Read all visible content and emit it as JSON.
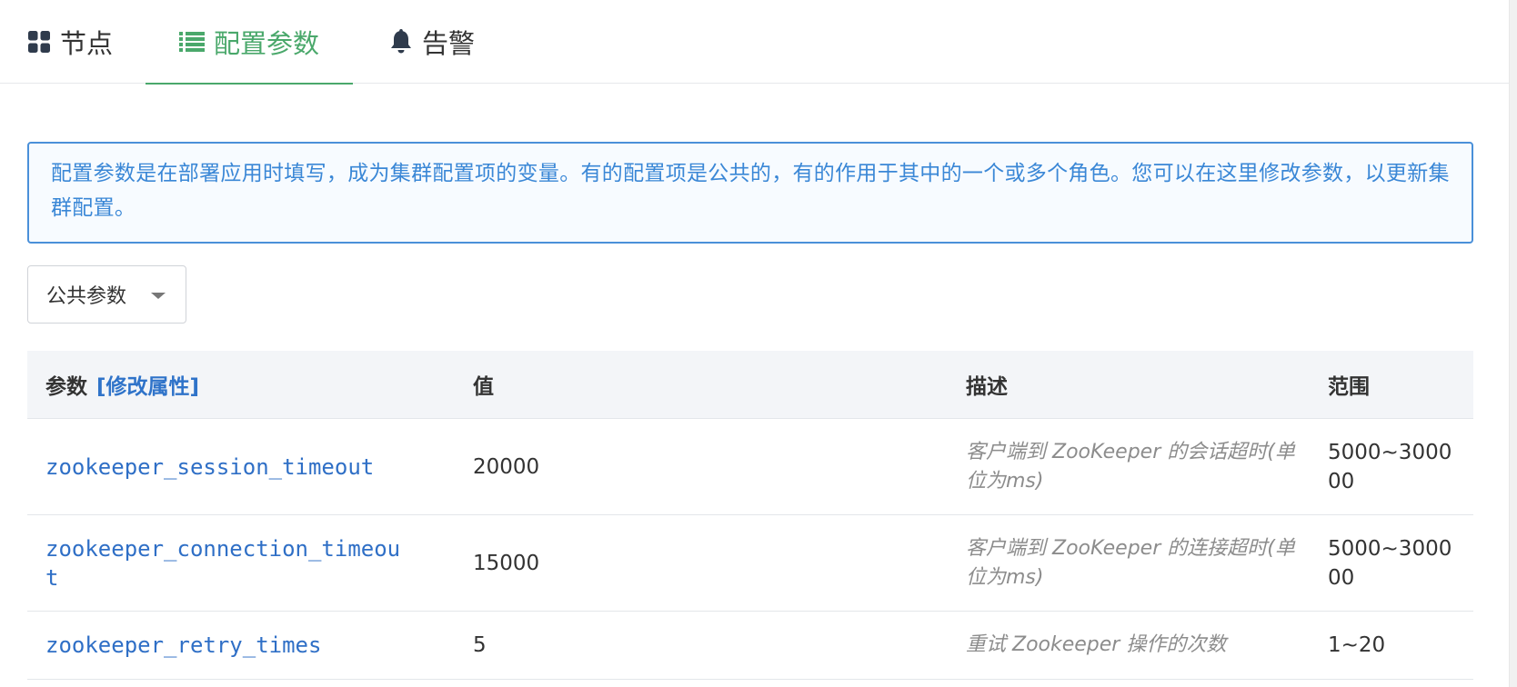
{
  "tabs": [
    {
      "label": "节点",
      "icon": "grid-icon",
      "active": false
    },
    {
      "label": "配置参数",
      "icon": "list-icon",
      "active": true
    },
    {
      "label": "告警",
      "icon": "bell-icon",
      "active": false
    }
  ],
  "alert": {
    "text": "配置参数是在部署应用时填写，成为集群配置项的变量。有的配置项是公共的，有的作用于其中的一个或多个角色。您可以在这里修改参数，以更新集群配置。"
  },
  "scope_select": {
    "value": "公共参数"
  },
  "table": {
    "headers": {
      "param": "参数",
      "edit_link": "[修改属性]",
      "value": "值",
      "description": "描述",
      "range": "范围"
    },
    "rows": [
      {
        "param": "zookeeper_session_timeout",
        "value": "20000",
        "description": "客户端到 ZooKeeper 的会话超时(单位为ms)",
        "range": "5000~300000"
      },
      {
        "param": "zookeeper_connection_timeout",
        "value": "15000",
        "description": "客户端到 ZooKeeper 的连接超时(单位为ms)",
        "range": "5000~300000"
      },
      {
        "param": "zookeeper_retry_times",
        "value": "5",
        "description": "重试 Zookeeper 操作的次数",
        "range": "1~20"
      }
    ]
  },
  "colors": {
    "accent_green": "#4aa86b",
    "link_blue": "#2f6fc6",
    "alert_blue": "#3a87d6"
  }
}
